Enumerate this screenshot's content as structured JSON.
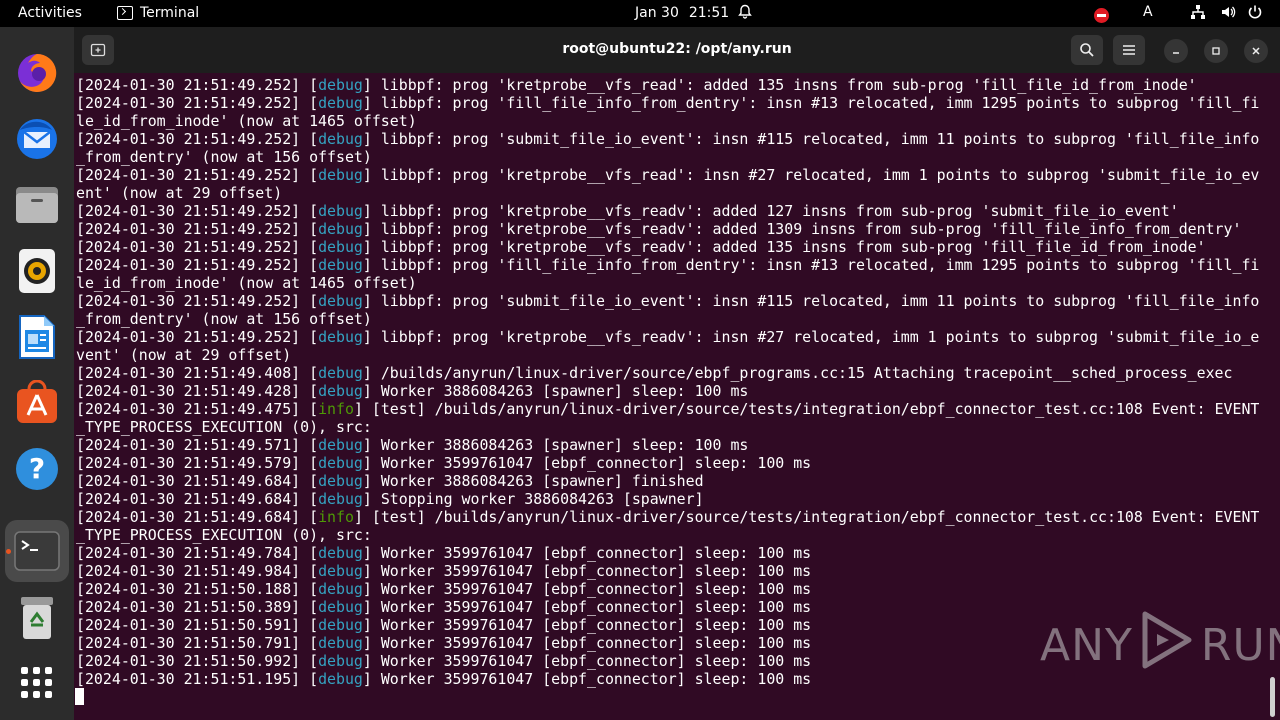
{
  "topbar": {
    "activities": "Activities",
    "app_name": "Terminal",
    "date": "Jan 30",
    "time": "21:51",
    "input_indicator": "A"
  },
  "dock": {
    "items": [
      {
        "name": "firefox-icon"
      },
      {
        "name": "thunderbird-icon"
      },
      {
        "name": "files-icon"
      },
      {
        "name": "rhythmbox-icon"
      },
      {
        "name": "writer-icon"
      },
      {
        "name": "app-center-icon"
      },
      {
        "name": "help-icon"
      },
      {
        "name": "terminal-icon"
      },
      {
        "name": "trash-icon"
      },
      {
        "name": "show-apps-icon"
      }
    ]
  },
  "window": {
    "title": "root@ubuntu22: /opt/any.run"
  },
  "terminal": {
    "lines": [
      {
        "ts": "[2024-01-30 21:51:49.252]",
        "level": "debug",
        "msg": " libbpf: prog 'kretprobe__vfs_read': added 135 insns from sub-prog 'fill_file_id_from_inode'"
      },
      {
        "ts": "[2024-01-30 21:51:49.252]",
        "level": "debug",
        "msg": " libbpf: prog 'fill_file_info_from_dentry': insn #13 relocated, imm 1295 points to subprog 'fill_fi"
      },
      {
        "ts": "",
        "level": "",
        "msg": "le_id_from_inode' (now at 1465 offset)"
      },
      {
        "ts": "[2024-01-30 21:51:49.252]",
        "level": "debug",
        "msg": " libbpf: prog 'submit_file_io_event': insn #115 relocated, imm 11 points to subprog 'fill_file_info"
      },
      {
        "ts": "",
        "level": "",
        "msg": "_from_dentry' (now at 156 offset)"
      },
      {
        "ts": "[2024-01-30 21:51:49.252]",
        "level": "debug",
        "msg": " libbpf: prog 'kretprobe__vfs_read': insn #27 relocated, imm 1 points to subprog 'submit_file_io_ev"
      },
      {
        "ts": "",
        "level": "",
        "msg": "ent' (now at 29 offset)"
      },
      {
        "ts": "[2024-01-30 21:51:49.252]",
        "level": "debug",
        "msg": " libbpf: prog 'kretprobe__vfs_readv': added 127 insns from sub-prog 'submit_file_io_event'"
      },
      {
        "ts": "[2024-01-30 21:51:49.252]",
        "level": "debug",
        "msg": " libbpf: prog 'kretprobe__vfs_readv': added 1309 insns from sub-prog 'fill_file_info_from_dentry'"
      },
      {
        "ts": "[2024-01-30 21:51:49.252]",
        "level": "debug",
        "msg": " libbpf: prog 'kretprobe__vfs_readv': added 135 insns from sub-prog 'fill_file_id_from_inode'"
      },
      {
        "ts": "[2024-01-30 21:51:49.252]",
        "level": "debug",
        "msg": " libbpf: prog 'fill_file_info_from_dentry': insn #13 relocated, imm 1295 points to subprog 'fill_fi"
      },
      {
        "ts": "",
        "level": "",
        "msg": "le_id_from_inode' (now at 1465 offset)"
      },
      {
        "ts": "[2024-01-30 21:51:49.252]",
        "level": "debug",
        "msg": " libbpf: prog 'submit_file_io_event': insn #115 relocated, imm 11 points to subprog 'fill_file_info"
      },
      {
        "ts": "",
        "level": "",
        "msg": "_from_dentry' (now at 156 offset)"
      },
      {
        "ts": "[2024-01-30 21:51:49.252]",
        "level": "debug",
        "msg": " libbpf: prog 'kretprobe__vfs_readv': insn #27 relocated, imm 1 points to subprog 'submit_file_io_e"
      },
      {
        "ts": "",
        "level": "",
        "msg": "vent' (now at 29 offset)"
      },
      {
        "ts": "[2024-01-30 21:51:49.408]",
        "level": "debug",
        "msg": " /builds/anyrun/linux-driver/source/ebpf_programs.cc:15 Attaching tracepoint__sched_process_exec"
      },
      {
        "ts": "[2024-01-30 21:51:49.428]",
        "level": "debug",
        "msg": " Worker 3886084263 [spawner] sleep: 100 ms"
      },
      {
        "ts": "[2024-01-30 21:51:49.475]",
        "level": "info",
        "msg": " [test] /builds/anyrun/linux-driver/source/tests/integration/ebpf_connector_test.cc:108 Event: EVENT"
      },
      {
        "ts": "",
        "level": "",
        "msg": "_TYPE_PROCESS_EXECUTION (0), src:"
      },
      {
        "ts": "[2024-01-30 21:51:49.571]",
        "level": "debug",
        "msg": " Worker 3886084263 [spawner] sleep: 100 ms"
      },
      {
        "ts": "[2024-01-30 21:51:49.579]",
        "level": "debug",
        "msg": " Worker 3599761047 [ebpf_connector] sleep: 100 ms"
      },
      {
        "ts": "[2024-01-30 21:51:49.684]",
        "level": "debug",
        "msg": " Worker 3886084263 [spawner] finished"
      },
      {
        "ts": "[2024-01-30 21:51:49.684]",
        "level": "debug",
        "msg": " Stopping worker 3886084263 [spawner]"
      },
      {
        "ts": "[2024-01-30 21:51:49.684]",
        "level": "info",
        "msg": " [test] /builds/anyrun/linux-driver/source/tests/integration/ebpf_connector_test.cc:108 Event: EVENT"
      },
      {
        "ts": "",
        "level": "",
        "msg": "_TYPE_PROCESS_EXECUTION (0), src:"
      },
      {
        "ts": "[2024-01-30 21:51:49.784]",
        "level": "debug",
        "msg": " Worker 3599761047 [ebpf_connector] sleep: 100 ms"
      },
      {
        "ts": "[2024-01-30 21:51:49.984]",
        "level": "debug",
        "msg": " Worker 3599761047 [ebpf_connector] sleep: 100 ms"
      },
      {
        "ts": "[2024-01-30 21:51:50.188]",
        "level": "debug",
        "msg": " Worker 3599761047 [ebpf_connector] sleep: 100 ms"
      },
      {
        "ts": "[2024-01-30 21:51:50.389]",
        "level": "debug",
        "msg": " Worker 3599761047 [ebpf_connector] sleep: 100 ms"
      },
      {
        "ts": "[2024-01-30 21:51:50.591]",
        "level": "debug",
        "msg": " Worker 3599761047 [ebpf_connector] sleep: 100 ms"
      },
      {
        "ts": "[2024-01-30 21:51:50.791]",
        "level": "debug",
        "msg": " Worker 3599761047 [ebpf_connector] sleep: 100 ms"
      },
      {
        "ts": "[2024-01-30 21:51:50.992]",
        "level": "debug",
        "msg": " Worker 3599761047 [ebpf_connector] sleep: 100 ms"
      },
      {
        "ts": "[2024-01-30 21:51:51.195]",
        "level": "debug",
        "msg": " Worker 3599761047 [ebpf_connector] sleep: 100 ms"
      }
    ]
  },
  "watermark": {
    "left": "ANY",
    "right": "RUN"
  },
  "colors": {
    "terminal_bg": "#300a24",
    "debug": "#34a3c2",
    "info": "#4e9a06",
    "accent": "#e95420"
  }
}
